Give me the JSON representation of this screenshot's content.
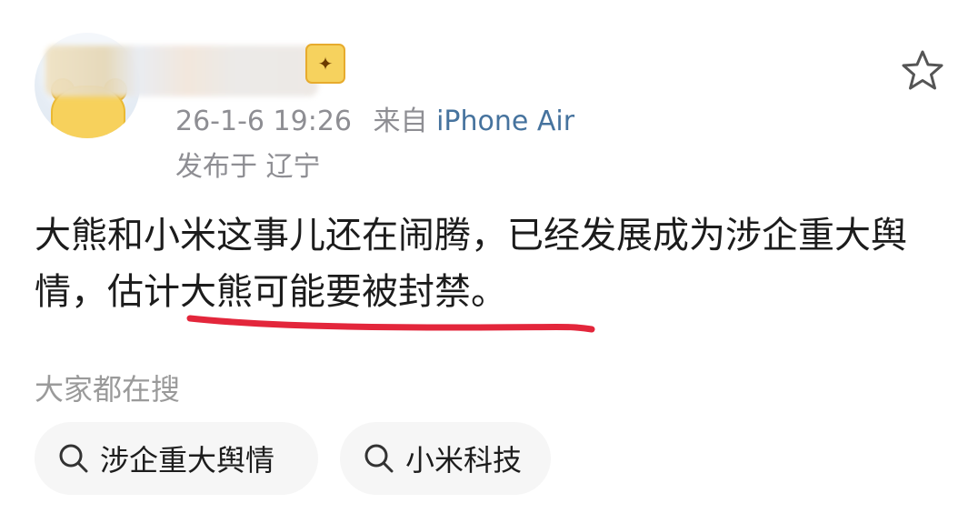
{
  "post": {
    "meta_time": "26-1-6 19:26",
    "meta_from": "来自",
    "meta_device": "iPhone Air",
    "location": "发布于 辽宁",
    "content_before": "大熊和小米这事儿还在闹腾，已经发展成为涉企重大舆情，",
    "content_highlight": "估计大熊可能要被封禁",
    "content_after": "。"
  },
  "icons": {
    "avatar": "bear-avatar",
    "badge": "vip-badge-icon",
    "favorite": "star-icon",
    "search": "search-icon"
  },
  "colors": {
    "device_link": "#46739e",
    "underline": "#e3263b",
    "chip_bg": "#f6f6f6",
    "meta_text": "#8e8e93"
  },
  "hot_search": {
    "title": "大家都在搜",
    "chips": [
      {
        "label": "涉企重大舆情"
      },
      {
        "label": "小米科技"
      }
    ]
  }
}
